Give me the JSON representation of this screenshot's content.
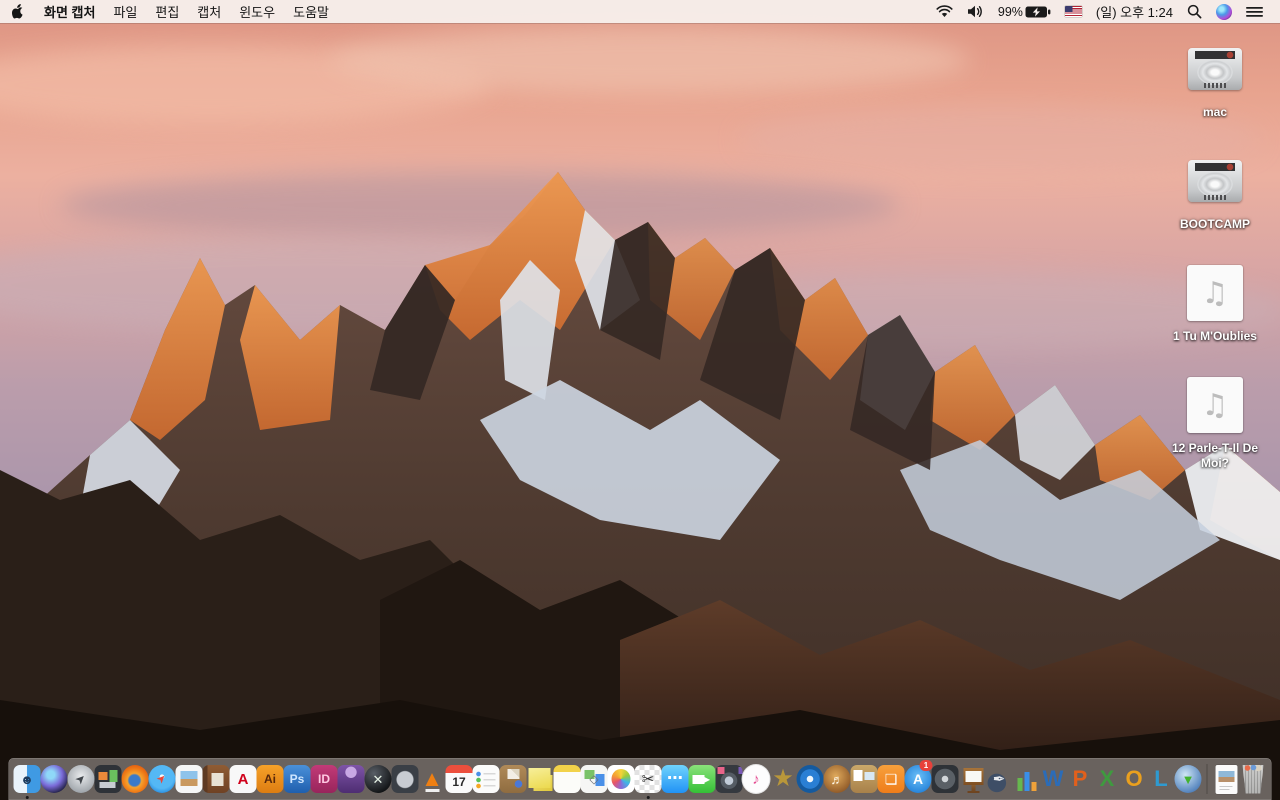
{
  "menu_bar": {
    "app_name": "화면 캡처",
    "menus": [
      "파일",
      "편집",
      "캡처",
      "윈도우",
      "도움말"
    ],
    "status": {
      "battery_percent": "99%",
      "battery_state": "charging",
      "clock": "(일) 오후 1:24",
      "input_source": "us-flag"
    }
  },
  "desktop": {
    "icons": [
      {
        "name": "drive-mac",
        "type": "drive",
        "label": "mac"
      },
      {
        "name": "drive-bootcamp",
        "type": "drive",
        "label": "BOOTCAMP"
      },
      {
        "name": "audio-file-1",
        "type": "audio",
        "label": "1 Tu M'Oublies"
      },
      {
        "name": "audio-file-12",
        "type": "audio",
        "label": "12 Parle-T-Il De Moi?"
      }
    ]
  },
  "dock": {
    "items": [
      {
        "name": "finder",
        "shape": "rounded",
        "bg": "linear-gradient(90deg,#e9f3fb 0 49%,#3f9ae3 51% 100%)",
        "glyph": "☻",
        "fg": "#1d3c5e",
        "gsize": 13,
        "running": true
      },
      {
        "name": "siri",
        "shape": "circle",
        "bg": "radial-gradient(circle at 38% 35%,#8fd8f8 0 16%,#7a6ad8 46%,#1a1a38 80%)"
      },
      {
        "name": "launchpad",
        "shape": "circle",
        "bg": "radial-gradient(circle at 50% 40%,#e9ebed,#9aa0a6 82%)",
        "glyph": "➤",
        "fg": "#41464c",
        "gsize": 12,
        "rot": -45
      },
      {
        "name": "mission-control",
        "shape": "rounded",
        "bg": "linear-gradient(#ea8a3a,#ea8a3a) 4px 7px/9px 8px no-repeat,linear-gradient(#6abf5e,#6abf5e) 15px 5px/8px 12px no-repeat,linear-gradient(#c8ccd2,#c8ccd2) 5px 17px/16px 6px no-repeat,#2e3238"
      },
      {
        "name": "firefox",
        "shape": "circle",
        "bg": "radial-gradient(circle at 48% 55%,#3a7ac8 0 26%,#f6a22e 34%,#ef7d18 55%,#e05a10 78%,#c2470c)"
      },
      {
        "name": "safari",
        "shape": "circle",
        "bg": "radial-gradient(circle at 50% 42%,#f2fafe 0 10%,#54b8f5 12% 55%,#1f84dc 85%)",
        "glyph": "➤",
        "fg": "#e8483a",
        "gsize": 11,
        "rot": -45
      },
      {
        "name": "preview",
        "shape": "rounded",
        "bg": "linear-gradient(180deg,#8ec3ea 0 55%,#c9995f 55% 100%) 5px 6px/17px 15px no-repeat,#f5f6f6"
      },
      {
        "name": "contacts-book",
        "shape": "rounded",
        "bg": "linear-gradient(#e8e2d4,#e8e2d4) 9px 8px/12px 13px no-repeat,linear-gradient(90deg,#5e3a22 0 5px,transparent 5px),linear-gradient(#8f5c34,#6f4224)"
      },
      {
        "name": "acrobat-reader",
        "shape": "rounded",
        "bg": "#f8f8f8",
        "glyph": "A",
        "fg": "#d0021b",
        "gsize": 15,
        "bold": true
      },
      {
        "name": "illustrator",
        "shape": "rounded",
        "bg": "linear-gradient(#f6a229,#dd7d12)",
        "glyph": "Ai",
        "fg": "#58280a",
        "gsize": 12,
        "bold": true
      },
      {
        "name": "photoshop",
        "shape": "rounded",
        "bg": "linear-gradient(#4a90d9,#1f5fae)",
        "glyph": "Ps",
        "fg": "#cfe6ff",
        "gsize": 12,
        "bold": true
      },
      {
        "name": "indesign",
        "shape": "rounded",
        "bg": "linear-gradient(#c23a78,#98255c)",
        "glyph": "ID",
        "fg": "#ffc9e2",
        "gsize": 12,
        "bold": true
      },
      {
        "name": "toast",
        "shape": "rounded",
        "bg": "radial-gradient(circle at 50% 26%,#c8a8e4 0 22%,transparent 24%),linear-gradient(#7e54a8,#4e2d72)"
      },
      {
        "name": "quicksilver",
        "shape": "circle",
        "bg": "radial-gradient(circle at 35% 30%,#585e66,#101214 78%)",
        "glyph": "✕",
        "fg": "#e6f2e6",
        "gsize": 13,
        "bold": true
      },
      {
        "name": "disk-gauge",
        "shape": "rounded",
        "bg": "radial-gradient(circle at 50% 52%,#c8ccd2 0 8px,#3a3f46 9px),#22252a"
      },
      {
        "name": "vlc",
        "shape": "plain",
        "bg": "linear-gradient(#efefef,#efefef) 7px 24px/14px 3px no-repeat",
        "glyph": "▲",
        "fg": "#ee7f12",
        "gsize": 22
      },
      {
        "name": "calendar",
        "shape": "rounded",
        "bg": "linear-gradient(#ec4f3d,#ec4f3d) 0 0/100% 8px no-repeat,#fafafa",
        "glyph": "17",
        "fg": "#2a2a2a",
        "gsize": 12,
        "bold": true,
        "gpad": 6
      },
      {
        "name": "reminders",
        "shape": "rounded",
        "bg": "radial-gradient(circle at 6px 9px,#4a90e8 0 2px,transparent 2.6px),radial-gradient(circle at 6px 15px,#58c257 0 2px,transparent 2.6px),radial-gradient(circle at 6px 21px,#f5a623 0 2px,transparent 2.6px),linear-gradient(#d8d8d8,#d8d8d8) 11px 8px/12px 1.5px no-repeat,linear-gradient(#d8d8d8,#d8d8d8) 11px 14px/12px 1.5px no-repeat,linear-gradient(#d8d8d8,#d8d8d8) 11px 20px/12px 1.5px no-repeat,#fbfbfb"
      },
      {
        "name": "mail-package",
        "shape": "rounded",
        "bg": "radial-gradient(circle at 19px 19px,#4a78d8 0 3.5px,transparent 4px),linear-gradient(45deg,#f2eee6 0 60%,#ddd5c2 61%) 8px 4px/12px 10px no-repeat,linear-gradient(#b08a58,#8f6c40)"
      },
      {
        "name": "stickies",
        "shape": "plain",
        "bg": "linear-gradient(165deg,#f7ef9a,#ecd94e) 2px 3px/22px 20px no-repeat,linear-gradient(150deg,#f2e278,#e0c83a) 7px 10px/19px 16px no-repeat"
      },
      {
        "name": "notepad",
        "shape": "rounded",
        "bg": "linear-gradient(#f2d24a,#f2d24a) 0 0/100% 7px no-repeat,#fcfcf9"
      },
      {
        "name": "diagram-compass",
        "shape": "rounded",
        "bg": "linear-gradient(#79c267,#79c267) 4px 5px/10px 9px no-repeat,linear-gradient(#4a90e8,#4a90e8) 15px 9px/9px 12px no-repeat,#f6f6f4",
        "glyph": "◇",
        "fg": "#6a6f76",
        "gsize": 12
      },
      {
        "name": "photos",
        "shape": "rounded",
        "bg": "#ffffff",
        "extra": "flower"
      },
      {
        "name": "grab-screen-capture",
        "shape": "rounded",
        "bg": "repeating-conic-gradient(#e2e2e2 0% 25%,#ffffff 0% 50%) 0 0/10px 10px",
        "glyph": "✂",
        "fg": "#2e2e2e",
        "gsize": 15,
        "running": true
      },
      {
        "name": "messages",
        "shape": "rounded",
        "bg": "linear-gradient(#6fd3fc,#2192f5)",
        "glyph": "⋯",
        "fg": "#ffffff",
        "gsize": 16,
        "bold": true
      },
      {
        "name": "facetime",
        "shape": "rounded",
        "bg": "linear-gradient(#ffffff,#ffffff) 4px 10px/12px 9px no-repeat,linear-gradient(#8ae27a,#34c036)",
        "glyph": "▸",
        "fg": "#ffffff",
        "gsize": 12,
        "gpadl": 10
      },
      {
        "name": "photo-booth",
        "shape": "rounded",
        "bg": "radial-gradient(circle at 50% 56%,#c2ccd8 0 4px,#555c64 4.5px 8px,transparent 8.5px),linear-gradient(#e8648a,#e8648a) 2px 2px/7px 7px no-repeat,linear-gradient(#7a5ab8,#7a5ab8) 23px 2px/6px 7px no-repeat,#35393f"
      },
      {
        "name": "itunes",
        "shape": "circle",
        "bg": "#fdfdfd",
        "glyph": "♪",
        "fg": "#e54f93",
        "gsize": 15,
        "border": "#e2e2e2"
      },
      {
        "name": "imovie",
        "shape": "plain",
        "bg": "transparent",
        "glyph": "★",
        "fg": "#b9973a",
        "gsize": 24
      },
      {
        "name": "idvd",
        "shape": "circle",
        "bg": "radial-gradient(circle at 50% 50%,#eef6fc 0 3px,#2a7fd4 3.5px 9.5px,#155a9e 10px)"
      },
      {
        "name": "garageband",
        "shape": "circle",
        "bg": "radial-gradient(circle at 45% 40%,#e0aa5c,#8a5424 82%)",
        "glyph": "♬",
        "fg": "#fff8ea",
        "gsize": 13
      },
      {
        "name": "corkboard",
        "shape": "rounded",
        "bg": "linear-gradient(#ffffff,#ffffff) 3px 5px/9px 11px no-repeat,linear-gradient(#d8e8f4,#d8e8f4) 14px 7px/10px 8px no-repeat,linear-gradient(#caa86a,#a8814a)"
      },
      {
        "name": "ibooks",
        "shape": "rounded",
        "bg": "linear-gradient(#f7a03c,#ef7d1a)",
        "glyph": "❏",
        "fg": "#ffffff",
        "gsize": 14
      },
      {
        "name": "app-store",
        "shape": "circle",
        "bg": "radial-gradient(circle at 50% 42%,#6cc0f8,#2280d8 82%)",
        "glyph": "A",
        "fg": "#ffffff",
        "gsize": 14,
        "bold": true,
        "badge": "1"
      },
      {
        "name": "dvd-player",
        "shape": "rounded",
        "bg": "radial-gradient(circle at 50% 50%,#d2d6da 0 3px,#5a6066 3.5px 10px,#2e3237 10.5px),#26292e"
      },
      {
        "name": "keynote",
        "shape": "plain",
        "bg": "linear-gradient(#f8f8f4,#f8f8f4) 7px 6px/16px 11px no-repeat,linear-gradient(#a8743a,#7e4f22) 5px 3px/20px 17px no-repeat,linear-gradient(#8a5c2e,#6e4420) 13px 20px/4px 7px no-repeat,linear-gradient(#6e4420,#6e4420) 9px 26px/12px 2px no-repeat"
      },
      {
        "name": "pages",
        "shape": "plain",
        "bg": "radial-gradient(circle at 42% 64%,#3e4e66 0 9px,transparent 9.5px)",
        "glyph": "✒",
        "fg": "#e8eaee",
        "gsize": 15
      },
      {
        "name": "numbers",
        "shape": "plain",
        "bg": "linear-gradient(#66b84e,#66b84e) 5px 13px/5px 13px no-repeat,linear-gradient(#3a8fe8,#3a8fe8) 12px 7px/5px 19px no-repeat,linear-gradient(#f0a23a,#f0a23a) 19px 17px/5px 9px no-repeat"
      },
      {
        "name": "ms-word",
        "shape": "plain",
        "bg": "transparent",
        "glyph": "W",
        "fg": "#2b6cb8",
        "gsize": 22,
        "bold": true
      },
      {
        "name": "ms-powerpoint",
        "shape": "plain",
        "bg": "transparent",
        "glyph": "P",
        "fg": "#e2601c",
        "gsize": 22,
        "bold": true
      },
      {
        "name": "ms-excel",
        "shape": "plain",
        "bg": "transparent",
        "glyph": "X",
        "fg": "#3f9a3f",
        "gsize": 22,
        "bold": true
      },
      {
        "name": "ms-outlook",
        "shape": "plain",
        "bg": "transparent",
        "glyph": "O",
        "fg": "#eaa01e",
        "gsize": 22,
        "bold": true
      },
      {
        "name": "ms-lync",
        "shape": "plain",
        "bg": "transparent",
        "glyph": "L",
        "fg": "#2e9ad0",
        "gsize": 22,
        "bold": true
      },
      {
        "name": "globe-downloader",
        "shape": "circle",
        "bg": "radial-gradient(circle at 40% 35%,#cfe6f5,#5a88c0 70%,#39639a)",
        "glyph": "▼",
        "fg": "#43b32e",
        "gsize": 13,
        "bold": true
      },
      {
        "name": "dock-separator",
        "type": "separator"
      },
      {
        "name": "document-file",
        "shape": "doc",
        "bg": "linear-gradient(#c8c8c8,#c8c8c8) 4px 21px/13px 1px no-repeat,linear-gradient(#c8c8c8,#c8c8c8) 4px 24px/10px 1px no-repeat,linear-gradient(180deg,#8fb8d8 0 55%,#b8906a 55% 100%) 3px 6px/16px 11px no-repeat,#fbfbfb"
      },
      {
        "name": "trash",
        "shape": "trash",
        "bg": "radial-gradient(circle at 7px 3px,#e86a4a 0 2.5px,transparent 3px),radial-gradient(circle at 13px 2.5px,#6a9ad8 0 2.5px,transparent 3px),radial-gradient(circle at 18px 3px,#d8d0c0 0 3px,transparent 3.5px),repeating-linear-gradient(90deg,rgba(255,255,255,.55) 0 1px,rgba(120,120,120,.5) 1px 3px),linear-gradient(#d8d8d6,#a8a8a6)"
      }
    ]
  },
  "colors": {
    "menubar_bg": "#f6f0ed",
    "dock_bg": "rgba(188,180,177,0.50)",
    "sky_top": "#dc9382",
    "sky_bottom": "#9a8da0",
    "sunlit_rock": "#e08348",
    "shadow_rock": "#352a24",
    "snow": "#e8e9ec",
    "badge_red": "#e8403a"
  }
}
